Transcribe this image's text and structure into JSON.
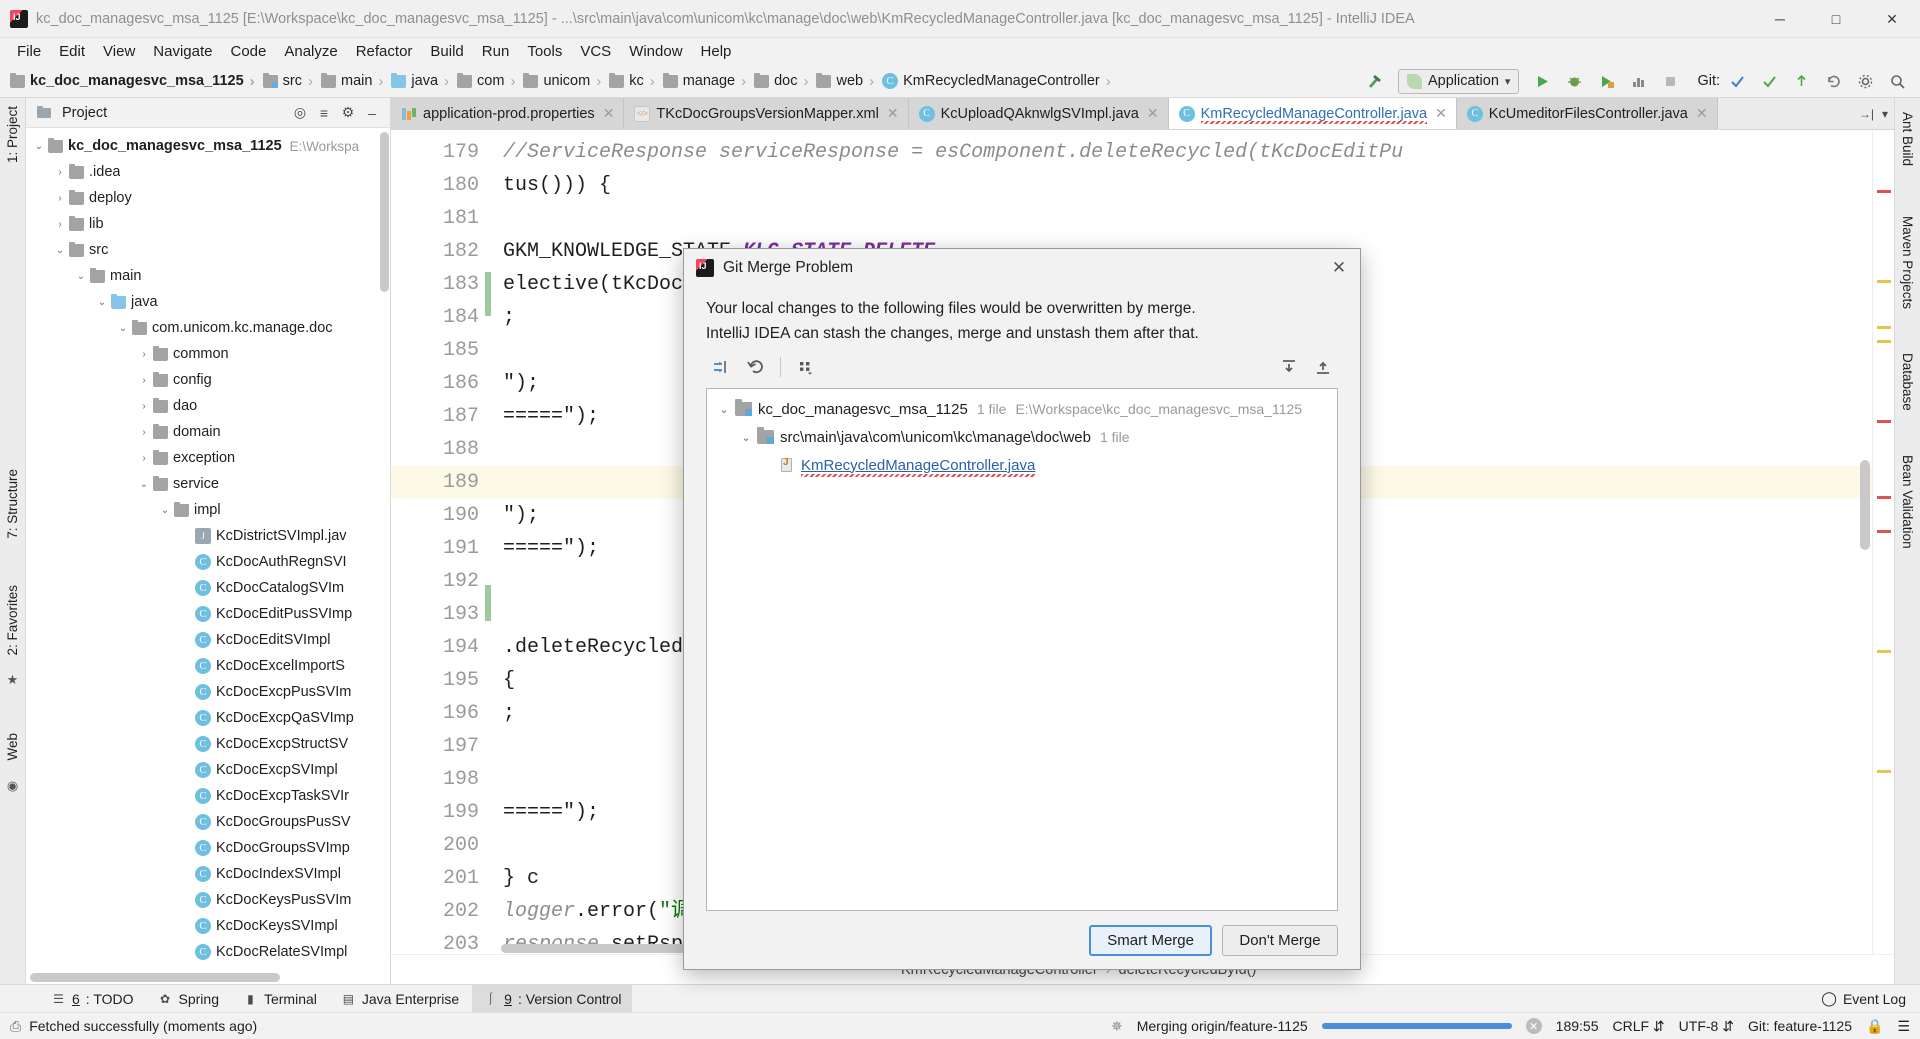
{
  "titlebar": {
    "title": "kc_doc_managesvc_msa_1125 [E:\\Workspace\\kc_doc_managesvc_msa_1125] - ...\\src\\main\\java\\com\\unicom\\kc\\manage\\doc\\web\\KmRecycledManageController.java [kc_doc_managesvc_msa_1125] - IntelliJ IDEA",
    "minimize": "─",
    "maximize": "□",
    "close": "✕"
  },
  "menubar": [
    "File",
    "Edit",
    "View",
    "Navigate",
    "Code",
    "Analyze",
    "Refactor",
    "Build",
    "Run",
    "Tools",
    "VCS",
    "Window",
    "Help"
  ],
  "navbar": {
    "crumbs": [
      {
        "label": "kc_doc_managesvc_msa_1125",
        "icon": "folder-icon",
        "bold": true
      },
      {
        "label": "src",
        "icon": "folder-source-icon",
        "bold": false
      },
      {
        "label": "main",
        "icon": "folder-icon",
        "bold": false
      },
      {
        "label": "java",
        "icon": "folder-java-icon",
        "bold": false
      },
      {
        "label": "com",
        "icon": "folder-package-icon",
        "bold": false
      },
      {
        "label": "unicom",
        "icon": "folder-package-icon",
        "bold": false
      },
      {
        "label": "kc",
        "icon": "folder-package-icon",
        "bold": false
      },
      {
        "label": "manage",
        "icon": "folder-package-icon",
        "bold": false
      },
      {
        "label": "doc",
        "icon": "folder-package-icon",
        "bold": false
      },
      {
        "label": "web",
        "icon": "folder-package-icon",
        "bold": false
      },
      {
        "label": "KmRecycledManageController",
        "icon": "class-icon",
        "bold": false
      }
    ],
    "run_config": "Application",
    "git_label": "Git:",
    "separator": "›"
  },
  "project_panel": {
    "title": "Project",
    "tree": [
      {
        "label": "kc_doc_managesvc_msa_1125",
        "arrow": "⌄",
        "icon": "folder-icon",
        "indent": 0,
        "bold": true,
        "dim": "E:\\Workspa"
      },
      {
        "label": ".idea",
        "arrow": "›",
        "icon": "folder-icon",
        "indent": 1,
        "bold": false,
        "dim": ""
      },
      {
        "label": "deploy",
        "arrow": "›",
        "icon": "folder-icon",
        "indent": 1,
        "bold": false,
        "dim": ""
      },
      {
        "label": "lib",
        "arrow": "›",
        "icon": "folder-icon",
        "indent": 1,
        "bold": false,
        "dim": ""
      },
      {
        "label": "src",
        "arrow": "⌄",
        "icon": "folder-icon",
        "indent": 1,
        "bold": false,
        "dim": ""
      },
      {
        "label": "main",
        "arrow": "⌄",
        "icon": "folder-icon",
        "indent": 2,
        "bold": false,
        "dim": ""
      },
      {
        "label": "java",
        "arrow": "⌄",
        "icon": "folder-java-icon",
        "indent": 3,
        "bold": false,
        "dim": ""
      },
      {
        "label": "com.unicom.kc.manage.doc",
        "arrow": "⌄",
        "icon": "folder-package-icon",
        "indent": 4,
        "bold": false,
        "dim": ""
      },
      {
        "label": "common",
        "arrow": "›",
        "icon": "folder-icon",
        "indent": 5,
        "bold": false,
        "dim": ""
      },
      {
        "label": "config",
        "arrow": "›",
        "icon": "folder-icon",
        "indent": 5,
        "bold": false,
        "dim": ""
      },
      {
        "label": "dao",
        "arrow": "›",
        "icon": "folder-icon",
        "indent": 5,
        "bold": false,
        "dim": ""
      },
      {
        "label": "domain",
        "arrow": "›",
        "icon": "folder-icon",
        "indent": 5,
        "bold": false,
        "dim": ""
      },
      {
        "label": "exception",
        "arrow": "›",
        "icon": "folder-icon",
        "indent": 5,
        "bold": false,
        "dim": ""
      },
      {
        "label": "service",
        "arrow": "⌄",
        "icon": "folder-icon",
        "indent": 5,
        "bold": false,
        "dim": ""
      },
      {
        "label": "impl",
        "arrow": "⌄",
        "icon": "folder-icon",
        "indent": 6,
        "bold": false,
        "dim": ""
      },
      {
        "label": "KcDistrictSVImpl.jav",
        "arrow": "",
        "icon": "java-file-icon",
        "indent": 7,
        "bold": false,
        "dim": ""
      },
      {
        "label": "KcDocAuthRegnSVI",
        "arrow": "",
        "icon": "class-icon",
        "indent": 7,
        "bold": false,
        "dim": ""
      },
      {
        "label": "KcDocCatalogSVIm",
        "arrow": "",
        "icon": "class-icon",
        "indent": 7,
        "bold": false,
        "dim": ""
      },
      {
        "label": "KcDocEditPusSVImp",
        "arrow": "",
        "icon": "class-icon",
        "indent": 7,
        "bold": false,
        "dim": ""
      },
      {
        "label": "KcDocEditSVImpl",
        "arrow": "",
        "icon": "class-icon",
        "indent": 7,
        "bold": false,
        "dim": ""
      },
      {
        "label": "KcDocExcelImportS",
        "arrow": "",
        "icon": "class-icon",
        "indent": 7,
        "bold": false,
        "dim": ""
      },
      {
        "label": "KcDocExcpPusSVIm",
        "arrow": "",
        "icon": "class-icon",
        "indent": 7,
        "bold": false,
        "dim": ""
      },
      {
        "label": "KcDocExcpQaSVImp",
        "arrow": "",
        "icon": "class-icon",
        "indent": 7,
        "bold": false,
        "dim": ""
      },
      {
        "label": "KcDocExcpStructSV",
        "arrow": "",
        "icon": "class-icon",
        "indent": 7,
        "bold": false,
        "dim": ""
      },
      {
        "label": "KcDocExcpSVImpl",
        "arrow": "",
        "icon": "class-icon",
        "indent": 7,
        "bold": false,
        "dim": ""
      },
      {
        "label": "KcDocExcpTaskSVIr",
        "arrow": "",
        "icon": "class-icon",
        "indent": 7,
        "bold": false,
        "dim": ""
      },
      {
        "label": "KcDocGroupsPusSV",
        "arrow": "",
        "icon": "class-icon",
        "indent": 7,
        "bold": false,
        "dim": ""
      },
      {
        "label": "KcDocGroupsSVImp",
        "arrow": "",
        "icon": "class-icon",
        "indent": 7,
        "bold": false,
        "dim": ""
      },
      {
        "label": "KcDocIndexSVImpl",
        "arrow": "",
        "icon": "class-icon",
        "indent": 7,
        "bold": false,
        "dim": ""
      },
      {
        "label": "KcDocKeysPusSVIm",
        "arrow": "",
        "icon": "class-icon",
        "indent": 7,
        "bold": false,
        "dim": ""
      },
      {
        "label": "KcDocKeysSVImpl",
        "arrow": "",
        "icon": "class-icon",
        "indent": 7,
        "bold": false,
        "dim": ""
      },
      {
        "label": "KcDocRelateSVImpl",
        "arrow": "",
        "icon": "class-icon",
        "indent": 7,
        "bold": false,
        "dim": ""
      }
    ]
  },
  "editor": {
    "tabs": [
      {
        "label": "application-prod.properties",
        "icon": "properties-file-icon",
        "active": false
      },
      {
        "label": "TKcDocGroupsVersionMapper.xml",
        "icon": "xml-file-icon",
        "active": false
      },
      {
        "label": "KcUploadQAknwlgSVImpl.java",
        "icon": "class-icon",
        "active": false
      },
      {
        "label": "KmRecycledManageController.java",
        "icon": "class-icon",
        "active": true
      },
      {
        "label": "KcUmeditorFilesController.java",
        "icon": "class-icon",
        "active": false
      }
    ],
    "tab_overflow": "→|",
    "line_numbers": [
      "179",
      "180",
      "181",
      "182",
      "183",
      "184",
      "185",
      "186",
      "187",
      "188",
      "189",
      "190",
      "191",
      "192",
      "193",
      "194",
      "195",
      "196",
      "197",
      "198",
      "199",
      "200",
      "201",
      "202",
      "203"
    ],
    "current_line_index": 10,
    "code_lines": [
      "//ServiceResponse serviceResponse = esComponent.deleteRecycled(tKcDocEditPu",
      "tus())) {",
      "",
      "GKM_KNOWLEDGE_STATE.KLG_STATE_DELETE",
      "elective(tKcDocEditPus);",
      ";",
      "",
      "\");",
      "=====\");",
      "",
      "",
      "\");",
      "=====\");",
      "",
      "",
      ".deleteRecycledById(knwlgId, splitId",
      "{",
      ";",
      "",
      "",
      "=====\");",
      "",
      "} c",
      "logger.error(\"调用删除工作流异常\", e);",
      "response.setRspcode(WebUtil.EXCEPTION);"
    ],
    "breadcrumb": [
      "KmRecycledManageController",
      "deleteRecycledById()"
    ],
    "breadcrumb_sep": "›"
  },
  "dialog": {
    "title": "Git Merge Problem",
    "message_line1": "Your local changes to the following files would be overwritten by merge.",
    "message_line2": "IntelliJ IDEA can stash the changes, merge and unstash them after that.",
    "toolbar": [
      {
        "name": "collapse-all-icon",
        "glyph": "⇥"
      },
      {
        "name": "revert-icon",
        "glyph": "↶"
      },
      {
        "name": "group-by-icon",
        "glyph": "∷"
      }
    ],
    "toolbar_right": [
      {
        "name": "expand-all-icon",
        "glyph": "↧"
      },
      {
        "name": "collapse-all-right-icon",
        "glyph": "↥"
      }
    ],
    "tree": [
      {
        "label": "kc_doc_managesvc_msa_1125",
        "arrow": "⌄",
        "count": "1 file",
        "path": "E:\\Workspace\\kc_doc_managesvc_msa_1125",
        "indent": 0,
        "type": "folder",
        "link": false
      },
      {
        "label": "src\\main\\java\\com\\unicom\\kc\\manage\\doc\\web",
        "arrow": "⌄",
        "count": "1 file",
        "path": "",
        "indent": 1,
        "type": "folder",
        "link": false
      },
      {
        "label": "KmRecycledManageController.java",
        "arrow": "",
        "count": "",
        "path": "",
        "indent": 2,
        "type": "java",
        "link": true
      }
    ],
    "buttons": [
      {
        "label": "Smart Merge",
        "default": true
      },
      {
        "label": "Don't Merge",
        "default": false
      }
    ],
    "close": "✕"
  },
  "left_strip": [
    {
      "label": "1: Project",
      "rot": true
    },
    {
      "label": "7: Structure",
      "rot": true
    },
    {
      "label": "2: Favorites",
      "rot": true
    },
    {
      "label": "Web",
      "rot": true
    }
  ],
  "right_strip": [
    {
      "label": "Ant Build",
      "rot": false
    },
    {
      "label": "Maven Projects",
      "rot": false
    },
    {
      "label": "Database",
      "rot": false
    },
    {
      "label": "Bean Validation",
      "rot": false
    }
  ],
  "bottom_tools": [
    {
      "key": "6",
      "label": ": TODO",
      "icon": "todo-icon",
      "selected": false
    },
    {
      "key": "",
      "label": "Spring",
      "icon": "spring-leaf-icon",
      "selected": false
    },
    {
      "key": "",
      "label": "Terminal",
      "icon": "terminal-icon",
      "selected": false
    },
    {
      "key": "",
      "label": "Java Enterprise",
      "icon": "java-enterprise-icon",
      "selected": false
    },
    {
      "key": "9",
      "label": ": Version Control",
      "icon": "branch-icon",
      "selected": true
    }
  ],
  "bottom_right_label": "Event Log",
  "statusbar": {
    "message": "Fetched successfully (moments ago)",
    "progress_label": "Merging origin/feature-1125",
    "caret": "189:55",
    "line_sep": "CRLF",
    "encoding": "UTF-8",
    "git_branch": "Git: feature-1125"
  }
}
